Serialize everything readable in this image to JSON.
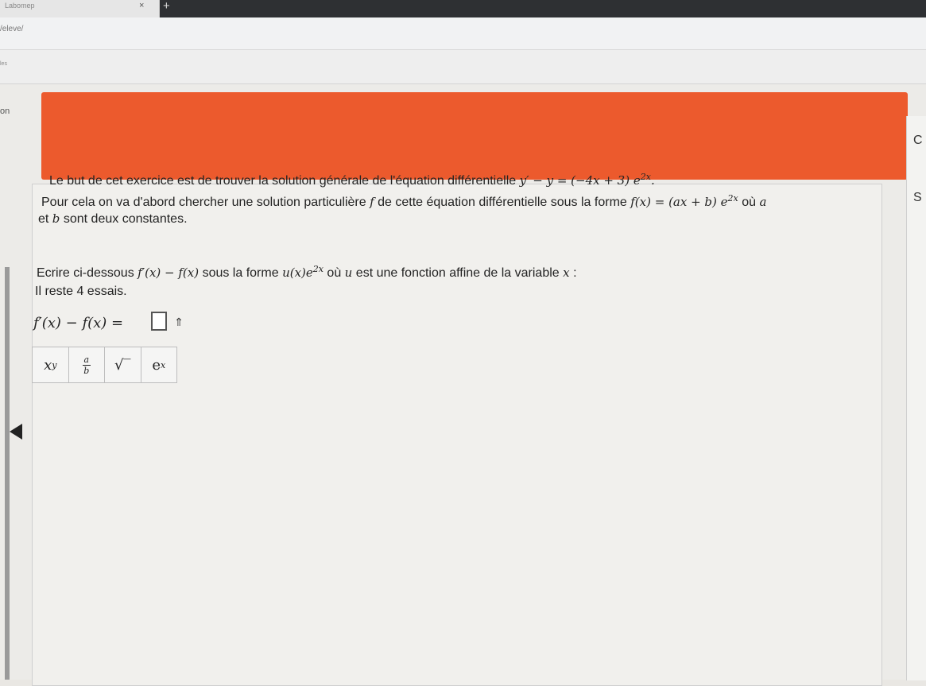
{
  "browser": {
    "tab_title": "Labomep",
    "tab_close": "×",
    "new_tab": "+",
    "url_fragment": "/eleve/",
    "bookmark_fragment": "les"
  },
  "page": {
    "section_fragment": "on",
    "side_letters": [
      "C",
      "S"
    ]
  },
  "exercise": {
    "line1_text": "Le but de cet exercice est de trouver la solution générale de l'équation différentielle",
    "line1_math": "y′ − y = (−4x + 3) e",
    "line1_exp": "2x",
    "line2_text": "Pour cela on va d'abord chercher une solution particulière",
    "line2_f": "f",
    "line2_text_b": "de cette équation différentielle sous la forme",
    "line2_math": "f(x) = (ax + b) e",
    "line2_exp": "2x",
    "line2_tail": "où",
    "line2_a": "a",
    "line3_text": "et",
    "line3_b": "b",
    "line3_tail": "sont deux constantes.",
    "line4_text": "Ecrire ci-dessous",
    "line4_math": "f′(x) − f(x)",
    "line4_text_b": "sous la forme",
    "line4_math_b": "u(x)e",
    "line4_exp": "2x",
    "line4_tail": "où",
    "line4_u": "u",
    "line4_tail_b": "est une fonction affine de la variable",
    "line4_x": "x",
    "line4_end": ":",
    "attempts": "Il reste 4 essais."
  },
  "answer": {
    "lhs": "f′(x) − f(x) =",
    "shift_symbol": "⇑"
  },
  "math_toolbar": {
    "power_base": "x",
    "power_exp": "y",
    "frac_num": "a",
    "frac_den": "b",
    "sqrt": "√‾",
    "exp_base": "e",
    "exp_exp": "x"
  }
}
